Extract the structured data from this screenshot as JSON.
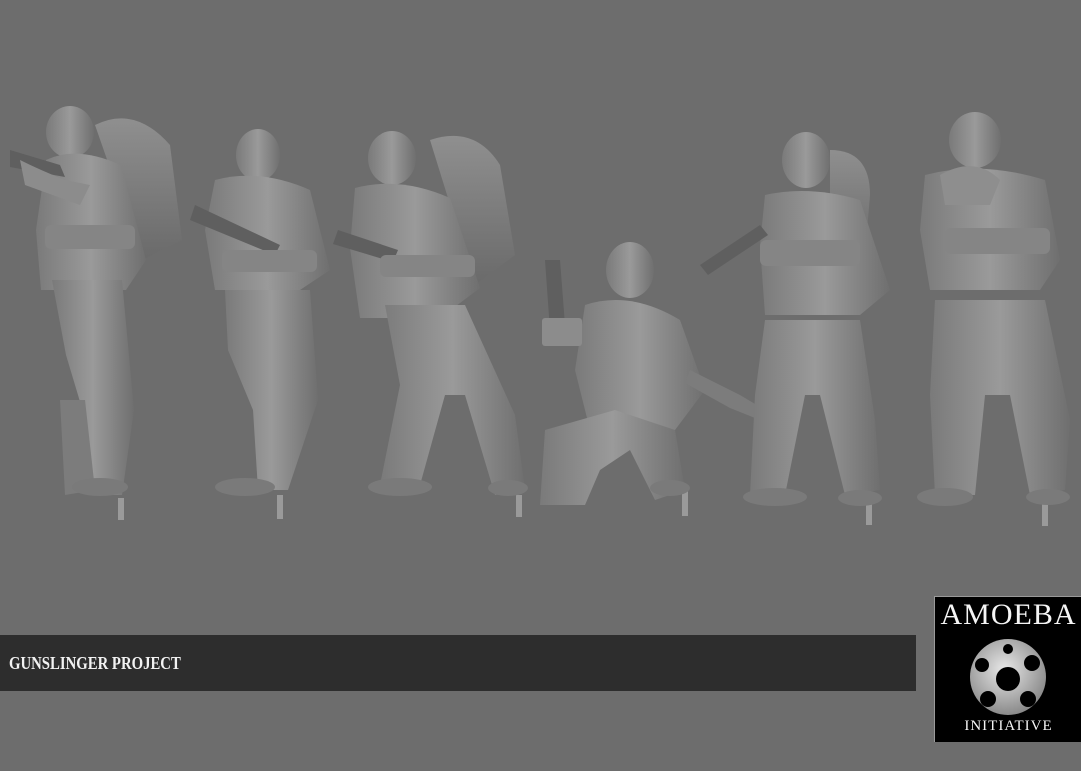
{
  "banner": {
    "title": "GUNSLINGER PROJECT"
  },
  "logo": {
    "top_text": "AMOEBA",
    "bottom_text": "INITIATIVE"
  },
  "colors": {
    "background": "#6d6d6d",
    "banner": "#2d2d2d",
    "figure": "#8a8a8a",
    "logo_bg": "#000000"
  },
  "figures": [
    {
      "pose": "standing-aiming-rifle",
      "icon": "soldier-figure"
    },
    {
      "pose": "standing-rifle-low",
      "icon": "soldier-figure"
    },
    {
      "pose": "advancing-rifle",
      "icon": "soldier-figure"
    },
    {
      "pose": "kneeling-pistol",
      "icon": "soldier-figure"
    },
    {
      "pose": "standing-rifle-raised",
      "icon": "soldier-figure"
    },
    {
      "pose": "standing-aiming-rifle-front",
      "icon": "soldier-figure"
    }
  ]
}
